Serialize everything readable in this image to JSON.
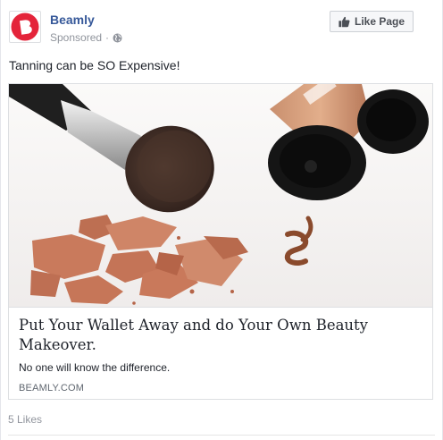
{
  "post": {
    "page_name": "Beamly",
    "sponsored_label": "Sponsored",
    "meta_separator": "·",
    "privacy_icon": "globe-icon",
    "like_page_label": "Like Page",
    "like_page_icon": "thumbs-up-icon",
    "text": "Tanning can be SO Expensive!"
  },
  "ad": {
    "headline": "Put Your Wallet Away and do Your Own Beauty Makeover.",
    "description": "No one will know the difference.",
    "domain": "BEAMLY.COM"
  },
  "footer": {
    "likes": "5 Likes"
  },
  "colors": {
    "brand_red": "#e4243a",
    "link_blue": "#365899",
    "muted": "#90949c"
  }
}
